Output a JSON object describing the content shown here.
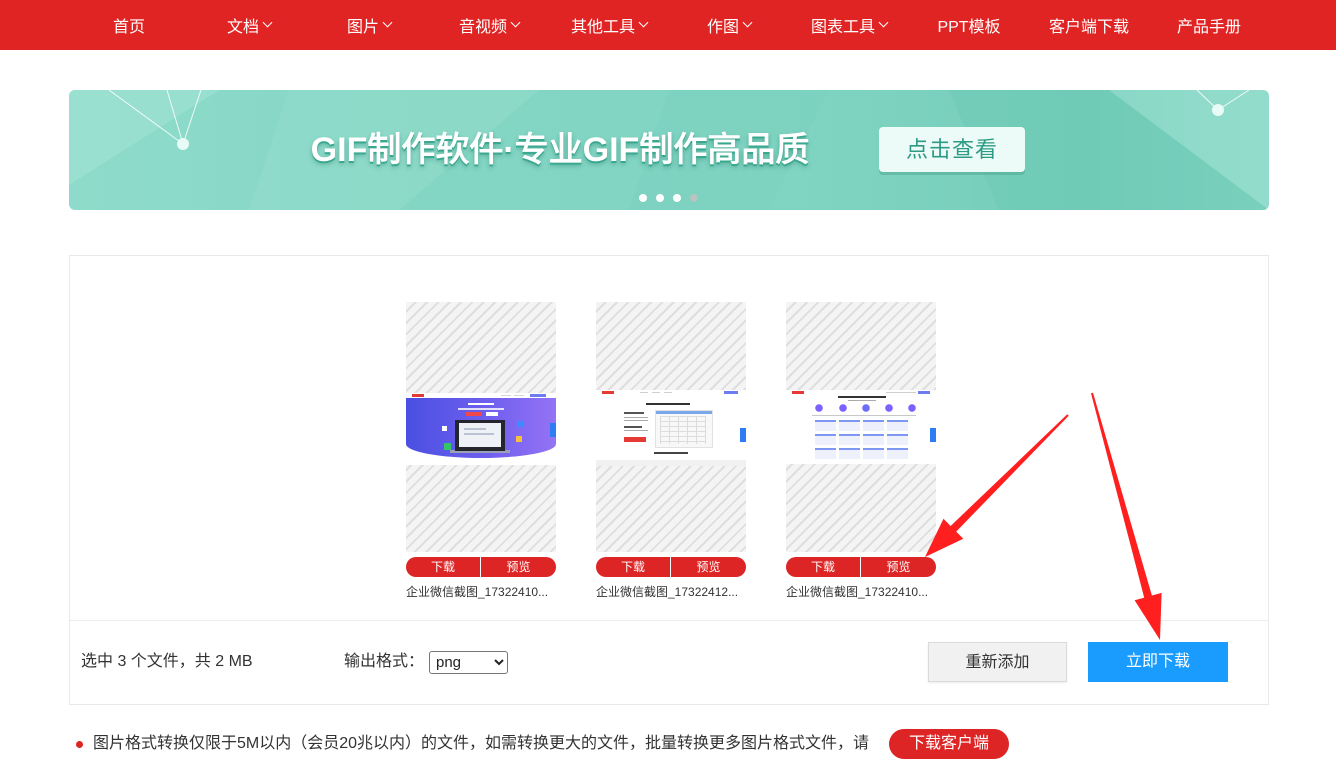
{
  "colors": {
    "nav_bg": "#e02424",
    "accent_red": "#dd2526",
    "primary_blue": "#1a9cff",
    "banner_teal": "#84d6c4"
  },
  "nav": {
    "items": [
      {
        "label": "首页",
        "dropdown": false
      },
      {
        "label": "文档",
        "dropdown": true,
        "icon": "chevron-down-icon"
      },
      {
        "label": "图片",
        "dropdown": true,
        "icon": "chevron-down-icon"
      },
      {
        "label": "音视频",
        "dropdown": true,
        "icon": "chevron-down-icon"
      },
      {
        "label": "其他工具",
        "dropdown": true,
        "icon": "chevron-down-icon"
      },
      {
        "label": "作图",
        "dropdown": true,
        "icon": "chevron-down-icon"
      },
      {
        "label": "图表工具",
        "dropdown": true,
        "icon": "chevron-down-icon"
      },
      {
        "label": "PPT模板",
        "dropdown": false
      },
      {
        "label": "客户端下载",
        "dropdown": false
      },
      {
        "label": "产品手册",
        "dropdown": false
      }
    ]
  },
  "banner": {
    "headline": "GIF制作软件·专业GIF制作高品质",
    "cta_label": "点击查看",
    "carousel": {
      "dot_count": 4,
      "active_index": 3
    }
  },
  "files": [
    {
      "name": "企业微信截图_17322410...",
      "download_label": "下载",
      "preview_label": "预览"
    },
    {
      "name": "企业微信截图_17322412...",
      "download_label": "下载",
      "preview_label": "预览"
    },
    {
      "name": "企业微信截图_17322410...",
      "download_label": "下载",
      "preview_label": "预览"
    }
  ],
  "summary": {
    "selection_text": "选中 3 个文件，共 2 MB",
    "output_format_label": "输出格式：",
    "output_format_value": "png",
    "re_add_label": "重新添加",
    "download_now_label": "立即下载"
  },
  "notice": {
    "text": "图片格式转换仅限于5M以内（会员20兆以内）的文件，如需转换更大的文件，批量转换更多图片格式文件，请",
    "client_download_label": "下载客户端"
  },
  "annotations": {
    "icon": "red-arrow",
    "arrow_color": "#ff1f1f"
  }
}
